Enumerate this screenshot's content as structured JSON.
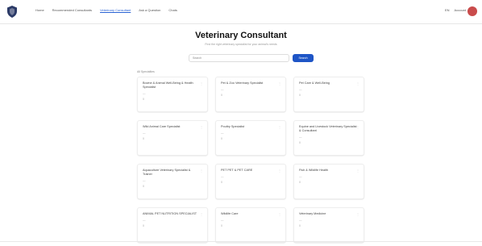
{
  "nav": {
    "items": [
      {
        "label": "Home",
        "active": false
      },
      {
        "label": "Recommended Consultants",
        "active": false
      },
      {
        "label": "Veterinary Consultant",
        "active": true
      },
      {
        "label": "Ask a Question",
        "active": false
      },
      {
        "label": "Chats",
        "active": false
      }
    ],
    "language": "EN",
    "account_label": "Account"
  },
  "page": {
    "title": "Veterinary Consultant",
    "subtitle": "Find the right veterinary specialist for your animal's needs",
    "search_placeholder": "Search",
    "search_button": "Search",
    "section_label": "All Specialties"
  },
  "cards": [
    {
      "title": "Bovine & Animal Well-Being & Health Specialist",
      "line1": "—",
      "line2": "0"
    },
    {
      "title": "Pet & Zoo Veterinary Specialist",
      "line1": "—",
      "line2": "0"
    },
    {
      "title": "Pet Care & Well-Being",
      "line1": "—",
      "line2": "0"
    },
    {
      "title": "Wild Animal Care Specialist",
      "line1": "—",
      "line2": "0"
    },
    {
      "title": "Poultry Specialist",
      "line1": "—",
      "line2": "0"
    },
    {
      "title": "Equine and Livestock Veterinary Specialist & Consultant",
      "line1": "—",
      "line2": "0"
    },
    {
      "title": "Aquaculture Veterinary Specialist & Trainer",
      "line1": "—",
      "line2": "0"
    },
    {
      "title": "PET PET & PET CARE",
      "line1": "—",
      "line2": "0"
    },
    {
      "title": "Fish & Wildlife Health",
      "line1": "—",
      "line2": "0"
    },
    {
      "title": "ANIMAL PET NUTRITION SPECIALIST",
      "line1": "—",
      "line2": "0"
    },
    {
      "title": "Wildlife Care",
      "line1": "—",
      "line2": "0"
    },
    {
      "title": "Veterinary Medicine",
      "line1": "—",
      "line2": "0"
    }
  ],
  "icons": {
    "logo": "shield-icon",
    "card_menu": "more-vertical-icon",
    "avatar": "user-avatar"
  },
  "colors": {
    "accent": "#1e55c6",
    "avatar": "#c94b4b"
  }
}
